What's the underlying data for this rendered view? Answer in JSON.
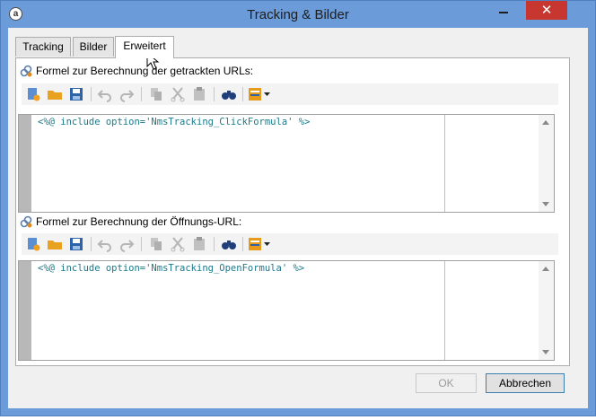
{
  "window": {
    "title": "Tracking & Bilder",
    "close_glyph": "✕"
  },
  "tabs": [
    {
      "label": "Tracking",
      "active": false
    },
    {
      "label": "Bilder",
      "active": false
    },
    {
      "label": "Erweitert",
      "active": true
    }
  ],
  "sections": [
    {
      "label": "Formel zur Berechnung der getrackten URLs:",
      "code": "<%@ include option='NmsTracking_ClickFormula' %>"
    },
    {
      "label": "Formel zur Berechnung der Öffnungs-URL:",
      "code": "<%@ include option='NmsTracking_OpenFormula' %>"
    }
  ],
  "buttons": {
    "ok": "OK",
    "cancel": "Abbrechen"
  },
  "colors": {
    "window_frame": "#6b9bd8",
    "close_button": "#c7372f",
    "code_text": "#1a7a8a"
  }
}
